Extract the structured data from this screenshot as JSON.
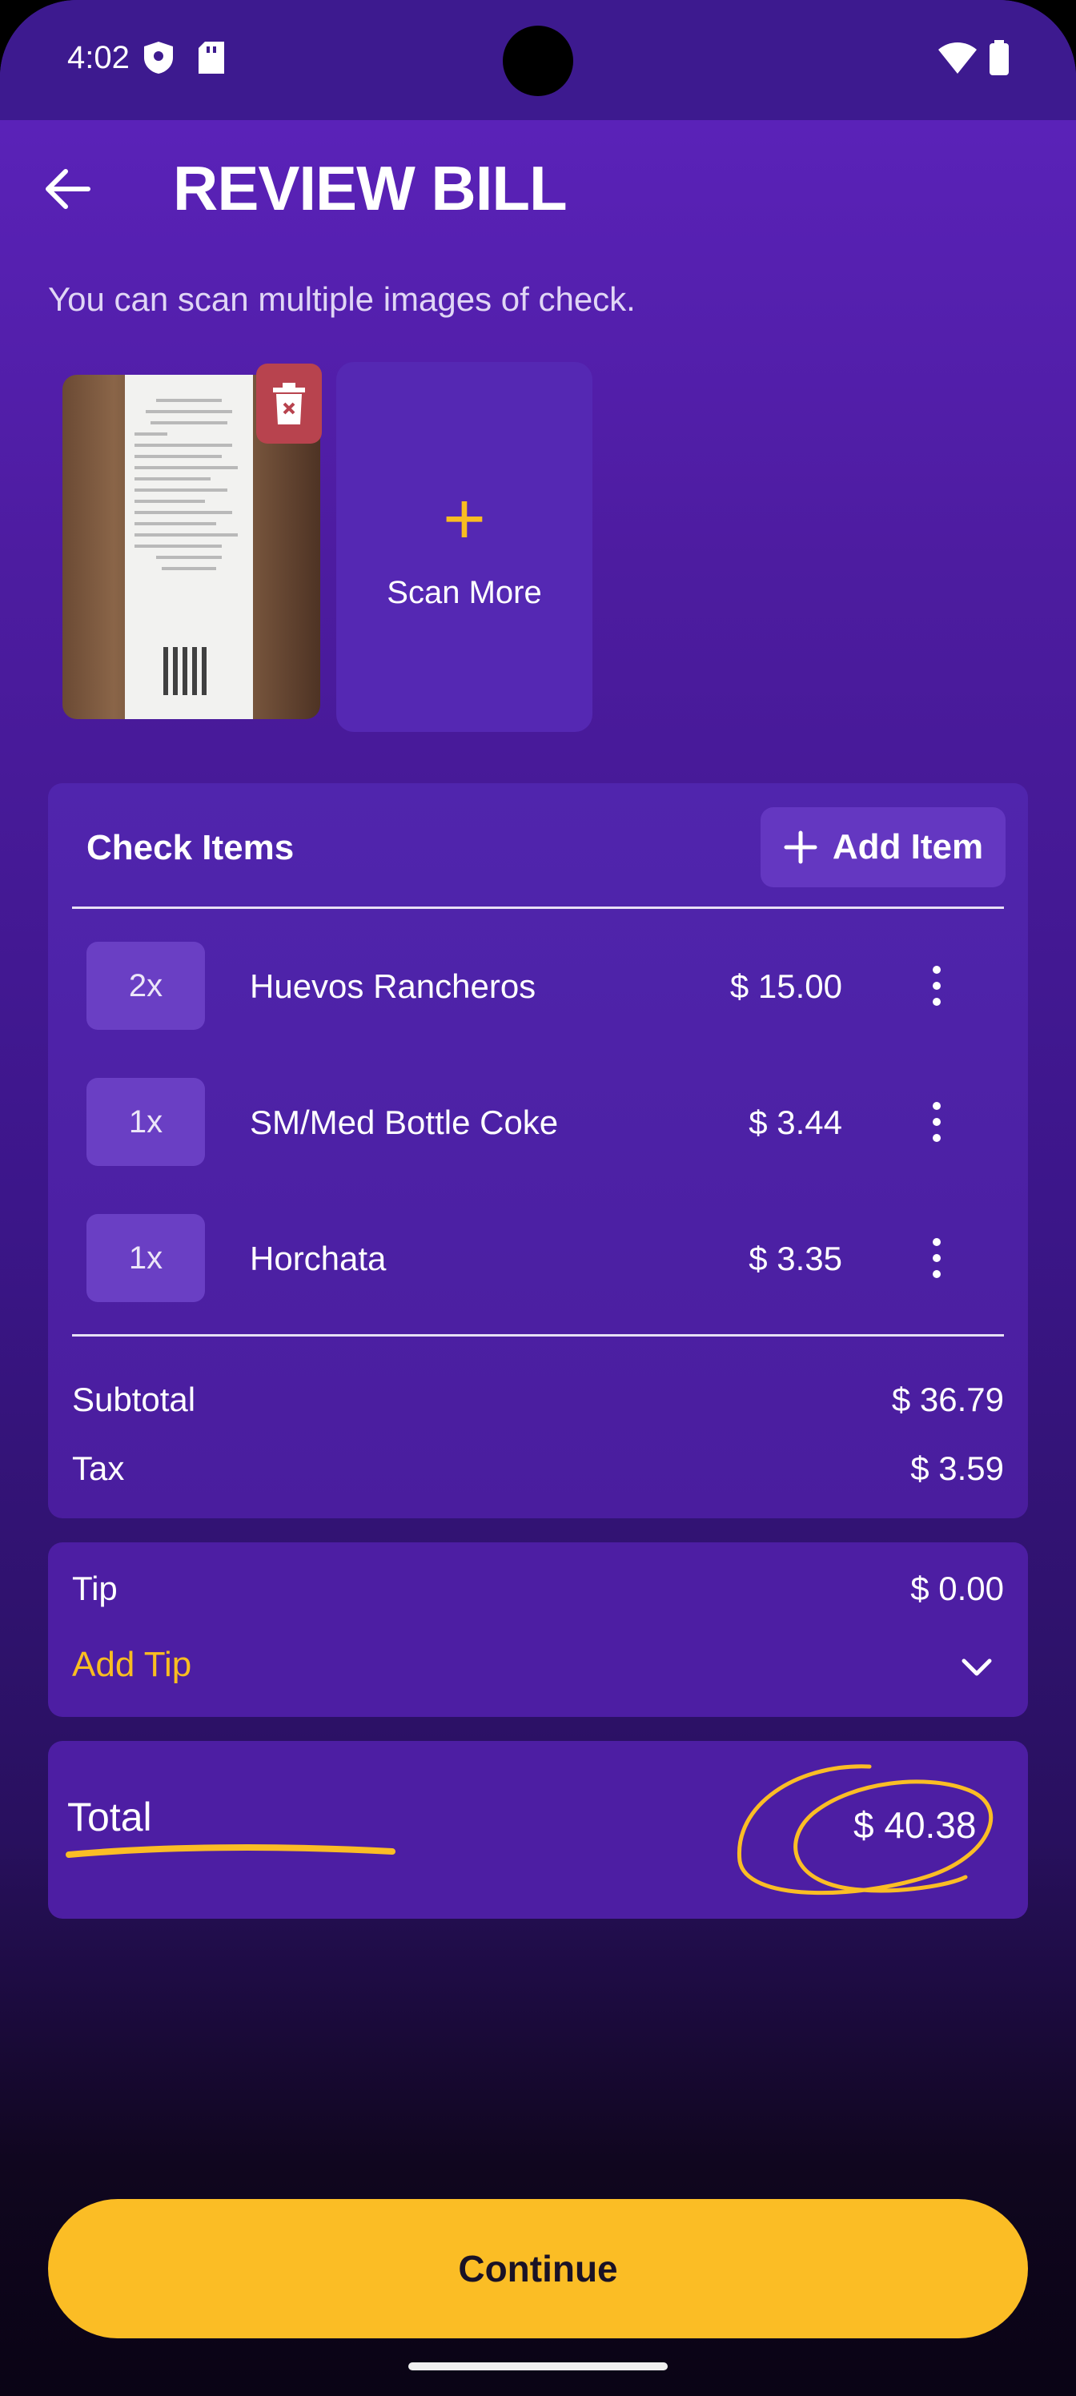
{
  "status_bar": {
    "time": "4:02"
  },
  "header": {
    "title": "REVIEW BILL"
  },
  "subtitle": "You can scan multiple images of check.",
  "scan_more": {
    "label": "Scan More",
    "plus": "+"
  },
  "check_items": {
    "title": "Check Items",
    "add_item_label": "Add Item",
    "items": [
      {
        "qty": "2x",
        "name": "Huevos Rancheros",
        "price": "$ 15.00"
      },
      {
        "qty": "1x",
        "name": "SM/Med Bottle Coke",
        "price": "$ 3.44"
      },
      {
        "qty": "1x",
        "name": "Horchata",
        "price": "$ 3.35"
      }
    ],
    "subtotal_label": "Subtotal",
    "subtotal_value": "$ 36.79",
    "tax_label": "Tax",
    "tax_value": "$ 3.59"
  },
  "tip": {
    "label": "Tip",
    "value": "$ 0.00",
    "add_tip_label": "Add Tip"
  },
  "total": {
    "label": "Total",
    "value": "$ 40.38"
  },
  "continue_label": "Continue",
  "colors": {
    "accent": "#fbbd25",
    "background": "#4d1ea3",
    "delete": "#b8434e"
  }
}
